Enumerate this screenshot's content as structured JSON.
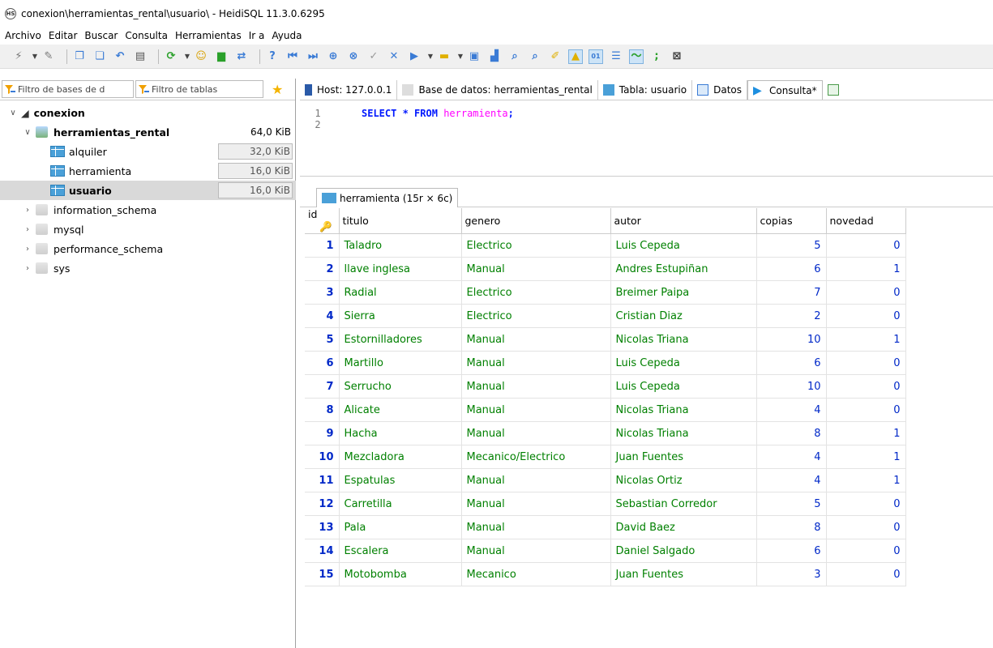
{
  "window": {
    "title": "conexion\\herramientas_rental\\usuario\\ - HeidiSQL 11.3.0.6295",
    "app_icon": "HS"
  },
  "menu": [
    "Archivo",
    "Editar",
    "Buscar",
    "Consulta",
    "Herramientas",
    "Ir a",
    "Ayuda"
  ],
  "filters": {
    "db_placeholder": "Filtro de bases de d",
    "table_placeholder": "Filtro de tablas"
  },
  "tree": {
    "root": "conexion",
    "active_db": {
      "name": "herramientas_rental",
      "size": "64,0 KiB"
    },
    "tables": [
      {
        "name": "alquiler",
        "size": "32,0 KiB"
      },
      {
        "name": "herramienta",
        "size": "16,0 KiB"
      },
      {
        "name": "usuario",
        "size": "16,0 KiB"
      }
    ],
    "other_dbs": [
      "information_schema",
      "mysql",
      "performance_schema",
      "sys"
    ]
  },
  "tabs": [
    "Host: 127.0.0.1",
    "Base de datos: herramientas_rental",
    "Tabla: usuario",
    "Datos",
    "Consulta*"
  ],
  "editor": {
    "lines": [
      "1",
      "2"
    ],
    "kw1": "SELECT",
    "star": " * ",
    "kw2": "FROM",
    "table": "herramienta",
    "semi": ";"
  },
  "result_tab": "herramienta (15r × 6c)",
  "grid": {
    "columns": [
      "id",
      "titulo",
      "genero",
      "autor",
      "copias",
      "novedad"
    ],
    "rows": [
      [
        "1",
        "Taladro",
        "Electrico",
        "Luis Cepeda",
        "5",
        "0"
      ],
      [
        "2",
        "llave inglesa",
        "Manual",
        "Andres Estupiñan",
        "6",
        "1"
      ],
      [
        "3",
        "Radial",
        "Electrico",
        "Breimer Paipa",
        "7",
        "0"
      ],
      [
        "4",
        "Sierra",
        "Electrico",
        "Cristian Diaz",
        "2",
        "0"
      ],
      [
        "5",
        "Estornilladores",
        "Manual",
        "Nicolas Triana",
        "10",
        "1"
      ],
      [
        "6",
        "Martillo",
        "Manual",
        "Luis Cepeda",
        "6",
        "0"
      ],
      [
        "7",
        "Serrucho",
        "Manual",
        "Luis Cepeda",
        "10",
        "0"
      ],
      [
        "8",
        "Alicate",
        "Manual",
        "Nicolas Triana",
        "4",
        "0"
      ],
      [
        "9",
        "Hacha",
        "Manual",
        "Nicolas Triana",
        "8",
        "1"
      ],
      [
        "10",
        "Mezcladora",
        "Mecanico/Electrico",
        "Juan Fuentes",
        "4",
        "1"
      ],
      [
        "11",
        "Espatulas",
        "Manual",
        "Nicolas Ortiz",
        "4",
        "1"
      ],
      [
        "12",
        "Carretilla",
        "Manual",
        "Sebastian Corredor",
        "5",
        "0"
      ],
      [
        "13",
        "Pala",
        "Manual",
        "David Baez",
        "8",
        "0"
      ],
      [
        "14",
        "Escalera",
        "Manual",
        "Daniel Salgado",
        "6",
        "0"
      ],
      [
        "15",
        "Motobomba",
        "Mecanico",
        "Juan Fuentes",
        "3",
        "0"
      ]
    ]
  },
  "colors": {
    "id": "#0028c8",
    "text": "#008000",
    "keyword": "#0018ff",
    "table_name": "#ff00ff"
  }
}
